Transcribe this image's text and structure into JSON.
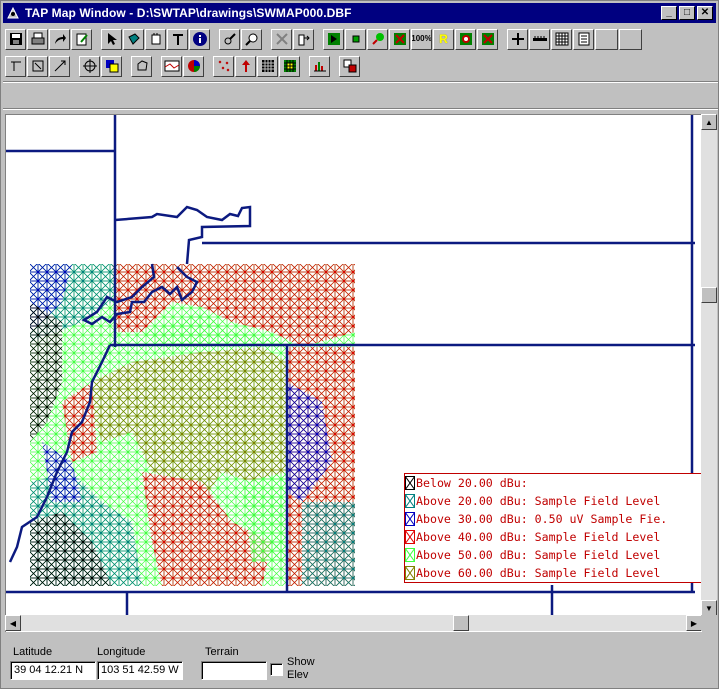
{
  "window": {
    "title": "TAP Map Window - D:\\SWTAP\\drawings\\SWMAP000.DBF",
    "controls": [
      "_",
      "□",
      "✕"
    ]
  },
  "toolbar1": [
    "save-icon",
    "print-icon",
    "redo-icon",
    "edit-icon",
    "pointer-icon",
    "select-icon",
    "pan-icon",
    "text-icon",
    "info-icon",
    "measure-icon",
    "zoom-icon",
    "delete-icon",
    "import-icon",
    "green-icon",
    "dot-icon",
    "marker-icon",
    "flag-icon",
    "zoom-100-icon",
    "r-icon",
    "refresh-icon",
    "grid-icon",
    "plus-icon",
    "ruler-icon",
    "table-icon",
    "list-icon"
  ],
  "toolbar1_text": {
    "zoom100": "100%",
    "r": "R"
  },
  "toolbar2": [
    "line-icon",
    "box-icon",
    "arrow-icon",
    "move-icon",
    "layers-icon",
    "polygon-icon",
    "profile-icon",
    "coverage-icon",
    "points-icon",
    "tower-icon",
    "grid-small-icon",
    "grid-color-icon",
    "chart-icon",
    "swap-icon"
  ],
  "legend": {
    "rows": [
      {
        "text": "Below  20.00 dBu:",
        "color": "#000000"
      },
      {
        "text": "Above  20.00 dBu: Sample Field Level",
        "color": "#008080"
      },
      {
        "text": "Above  30.00 dBu: 0.50 uV Sample Fie.",
        "color": "#0000c0"
      },
      {
        "text": "Above  40.00 dBu: Sample Field Level",
        "color": "#e00000"
      },
      {
        "text": "Above  50.00 dBu: Sample Field Level",
        "color": "#40ff40"
      },
      {
        "text": "Above  60.00 dBu: Sample Field Level",
        "color": "#808000"
      }
    ]
  },
  "status": {
    "latitude_label": "Latitude",
    "latitude_value": "39 04 12.21 N",
    "longitude_label": "Longitude",
    "longitude_value": "103 51 42.59 W",
    "terrain_label": "Terrain",
    "terrain_value": "",
    "show_elev_label_1": "Show",
    "show_elev_label_2": "Elev"
  },
  "colors": {
    "title_bar": "#000080",
    "boundary": "#0c1a80",
    "legend_text": "#c00000"
  }
}
